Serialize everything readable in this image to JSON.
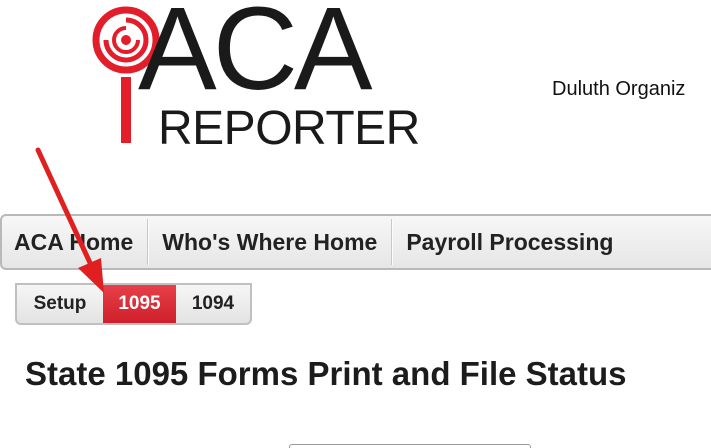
{
  "logo": {
    "primary_text": "ACA",
    "secondary_text": "REPORTER",
    "icon": "magnifier-pin-icon",
    "colors": {
      "accent": "#e31e2b",
      "text": "#1a1a1a"
    }
  },
  "header": {
    "org_name": "Duluth Organiz"
  },
  "main_nav": {
    "items": [
      {
        "label": "ACA Home"
      },
      {
        "label": "Who's Where Home"
      },
      {
        "label": "Payroll Processing"
      }
    ]
  },
  "sub_nav": {
    "items": [
      {
        "label": "Setup",
        "active": false
      },
      {
        "label": "1095",
        "active": true
      },
      {
        "label": "1094",
        "active": false
      }
    ],
    "active_color": "#dc2c36"
  },
  "main": {
    "title": "State 1095 Forms Print and File Status"
  },
  "annotation": {
    "icon": "red-arrow-icon",
    "color": "#e02020"
  }
}
